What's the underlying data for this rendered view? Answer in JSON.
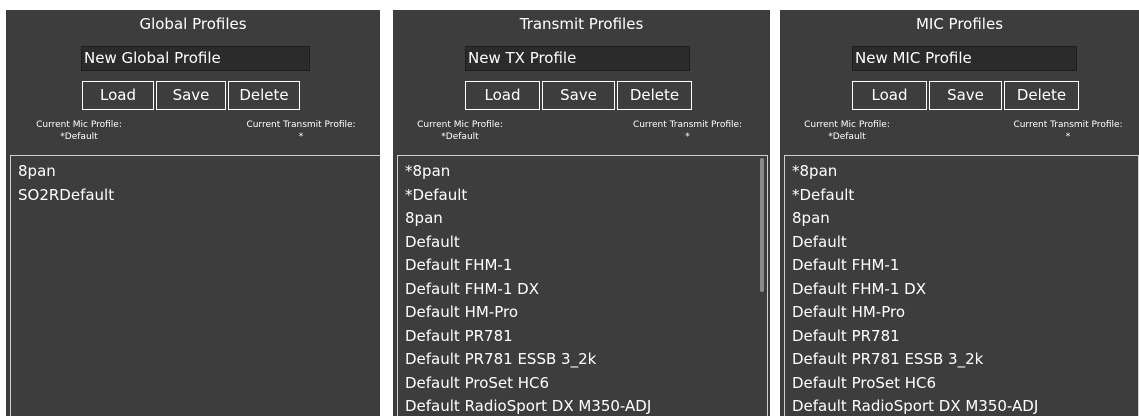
{
  "panels": [
    {
      "title": "Global Profiles",
      "name_value": "New Global Profile",
      "buttons": {
        "load": "Load",
        "save": "Save",
        "delete": "Delete"
      },
      "current_mic_label": "Current Mic Profile:",
      "current_mic_value": "*Default",
      "current_tx_label": "Current Transmit Profile:",
      "current_tx_value": "*",
      "items": [
        "8pan",
        "SO2RDefault"
      ]
    },
    {
      "title": "Transmit Profiles",
      "name_value": "New TX Profile",
      "buttons": {
        "load": "Load",
        "save": "Save",
        "delete": "Delete"
      },
      "current_mic_label": "Current Mic Profile:",
      "current_mic_value": "*Default",
      "current_tx_label": "Current Transmit Profile:",
      "current_tx_value": "*",
      "items": [
        "*8pan",
        "*Default",
        "8pan",
        "Default",
        "Default FHM-1",
        "Default FHM-1 DX",
        "Default HM-Pro",
        "Default PR781",
        "Default PR781 ESSB 3_2k",
        "Default ProSet HC6",
        "Default RadioSport DX M350-ADJ"
      ]
    },
    {
      "title": "MIC Profiles",
      "name_value": "New MIC Profile",
      "buttons": {
        "load": "Load",
        "save": "Save",
        "delete": "Delete"
      },
      "current_mic_label": "Current Mic Profile:",
      "current_mic_value": "*Default",
      "current_tx_label": "Current Transmit Profile:",
      "current_tx_value": "*",
      "items": [
        "*8pan",
        "*Default",
        "8pan",
        "Default",
        "Default FHM-1",
        "Default FHM-1 DX",
        "Default HM-Pro",
        "Default PR781",
        "Default PR781 ESSB 3_2k",
        "Default ProSet HC6",
        "Default RadioSport DX M350-ADJ"
      ]
    }
  ],
  "colors": {
    "panel_bg": "#3d3d3d",
    "input_bg": "#2b2b2b",
    "text": "#ffffff",
    "list_border": "#cfcfcf",
    "scrollbar": "#8a8a8a"
  }
}
